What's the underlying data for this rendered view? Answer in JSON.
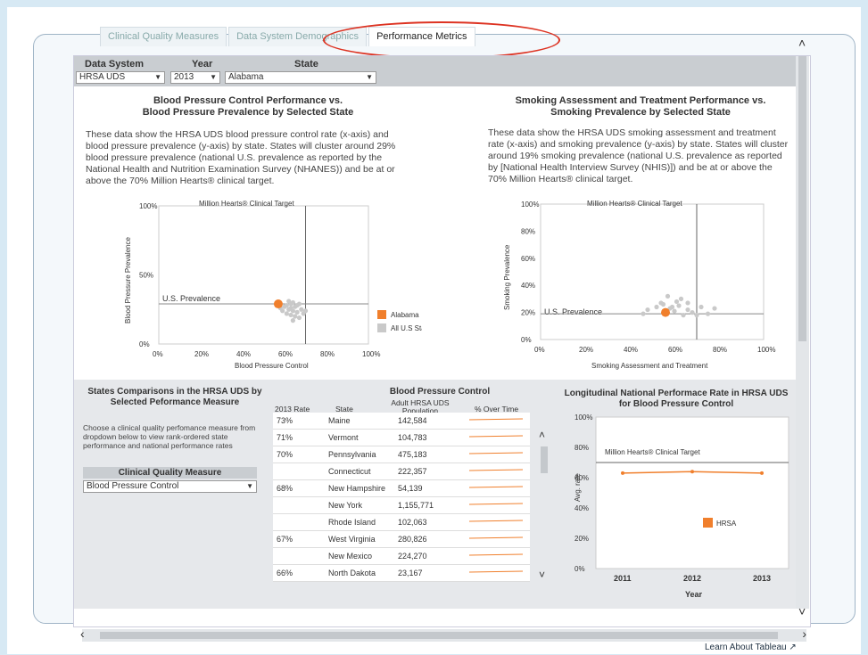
{
  "tabs": [
    "Clinical Quality Measures",
    "Data System Demographics",
    "Performance Metrics"
  ],
  "filters": {
    "data_system_label": "Data System",
    "data_system_value": "HRSA UDS",
    "year_label": "Year",
    "year_value": "2013",
    "state_label": "State",
    "state_value": "Alabama"
  },
  "bp_panel": {
    "title_line1": "Blood Pressure Control Performance vs.",
    "title_line2": "Blood Pressure Prevalence by Selected State",
    "desc": "These data show the HRSA UDS blood pressure control rate (x-axis) and blood pressure prevalence (y-axis) by state. States will cluster around 29% blood pressure prevalence (national U.S. prevalence as reported by the National Health and Nutrition Examination Survey (NHANES)) and be at or above the 70% Million Hearts® clinical target.",
    "target_label": "Million Hearts® Clinical Target",
    "prevalence_label": "U.S. Prevalence",
    "xlabel": "Blood Pressure Control",
    "ylabel": "Blood Pressure Prevalence",
    "legend_selected": "Alabama",
    "legend_all": "All U.S States"
  },
  "smoking_panel": {
    "title_line1": "Smoking Assessment and Treatment Performance vs.",
    "title_line2": "Smoking Prevalence by Selected State",
    "desc": "These data show the HRSA UDS smoking assessment and treatment rate (x-axis) and smoking prevalence (y-axis) by state. States will cluster around 19% smoking prevalence (national U.S. prevalence as reported by [National Health Interview Survey (NHIS)]) and be at or above the 70% Million Hearts® clinical target.",
    "target_label": "Million Hearts® Clinical Target",
    "prevalence_label": "U.S. Prevalence",
    "xlabel": "Smoking Assessment and Treatment",
    "ylabel": "Smoking Prevalence"
  },
  "comparison": {
    "title_line1": "States Comparisons in the HRSA UDS by",
    "title_line2": "Selected Peformance Measure",
    "hint": "Choose a clinical quality perfomance measure from dropdown below to view rank-ordered state performance and national performance rates",
    "cqm_label": "Clinical Quality Measure",
    "cqm_value": "Blood Pressure Control"
  },
  "bp_table": {
    "title": "Blood Pressure Control",
    "headers": [
      "2013 Rate",
      "State",
      "Adult HRSA UDS Population",
      "% Over Time"
    ],
    "rows": [
      {
        "rate": "73%",
        "state": "Maine",
        "pop": "142,584"
      },
      {
        "rate": "71%",
        "state": "Vermont",
        "pop": "104,783"
      },
      {
        "rate": "70%",
        "state": "Pennsylvania",
        "pop": "475,183"
      },
      {
        "rate": "",
        "state": "Connecticut",
        "pop": "222,357"
      },
      {
        "rate": "68%",
        "state": "New Hampshire",
        "pop": "54,139"
      },
      {
        "rate": "",
        "state": "New York",
        "pop": "1,155,771"
      },
      {
        "rate": "",
        "state": "Rhode Island",
        "pop": "102,063"
      },
      {
        "rate": "67%",
        "state": "West Virginia",
        "pop": "280,826"
      },
      {
        "rate": "",
        "state": "New Mexico",
        "pop": "224,270"
      },
      {
        "rate": "66%",
        "state": "North Dakota",
        "pop": "23,167"
      }
    ]
  },
  "longitudinal": {
    "title_line1": "Longitudinal National Performace Rate in HRSA UDS",
    "title_line2": "for Blood Pressure Control",
    "ylabel": "Avg. rate",
    "xlabel": "Year",
    "target_label": "Million Hearts® Clinical Target",
    "legend": "HRSA"
  },
  "footer": {
    "learn": "Learn About Tableau"
  },
  "colors": {
    "accent": "#f07f2c",
    "scatter": "#c9c9c9",
    "ellipse": "#d32f2f"
  },
  "chart_data": [
    {
      "type": "scatter",
      "title": "Blood Pressure Control Performance vs. Blood Pressure Prevalence by Selected State",
      "xlabel": "Blood Pressure Control",
      "ylabel": "Blood Pressure Prevalence",
      "xlim": [
        0,
        100
      ],
      "ylim": [
        0,
        100
      ],
      "xticks": [
        "0%",
        "20%",
        "40%",
        "60%",
        "80%",
        "100%"
      ],
      "yticks": [
        "0%",
        "50%",
        "100%"
      ],
      "series": [
        {
          "name": "Alabama",
          "points": [
            [
              57,
              29
            ]
          ]
        },
        {
          "name": "All U.S States",
          "points": [
            [
              60,
              27
            ],
            [
              62,
              25
            ],
            [
              63,
              29
            ],
            [
              64,
              24
            ],
            [
              61,
              22
            ],
            [
              65,
              27
            ],
            [
              66,
              23
            ],
            [
              63,
              21
            ],
            [
              68,
              25
            ],
            [
              67,
              19
            ],
            [
              59,
              24
            ],
            [
              62,
              31
            ],
            [
              64,
              30
            ],
            [
              66,
              28
            ],
            [
              58,
              26
            ],
            [
              69,
              22
            ],
            [
              70,
              24
            ],
            [
              67,
              29
            ],
            [
              61,
              28
            ],
            [
              65,
              20
            ],
            [
              64,
              17
            ],
            [
              63,
              26
            ]
          ]
        }
      ]
    },
    {
      "type": "scatter",
      "title": "Smoking Assessment and Treatment Performance vs. Smoking Prevalence by Selected State",
      "xlabel": "Smoking Assessment and Treatment",
      "ylabel": "Smoking Prevalence",
      "xlim": [
        0,
        100
      ],
      "ylim": [
        0,
        100
      ],
      "xticks": [
        "0%",
        "20%",
        "40%",
        "60%",
        "80%",
        "100%"
      ],
      "yticks": [
        "0%",
        "20%",
        "40%",
        "60%",
        "80%",
        "100%"
      ],
      "series": [
        {
          "name": "Alabama",
          "points": [
            [
              56,
              20
            ]
          ]
        },
        {
          "name": "All U.S States",
          "points": [
            [
              48,
              22
            ],
            [
              52,
              24
            ],
            [
              55,
              26
            ],
            [
              58,
              23
            ],
            [
              60,
              21
            ],
            [
              62,
              25
            ],
            [
              64,
              18
            ],
            [
              66,
              22
            ],
            [
              68,
              20
            ],
            [
              72,
              24
            ],
            [
              75,
              19
            ],
            [
              78,
              23
            ],
            [
              54,
              27
            ],
            [
              61,
              28
            ],
            [
              57,
              32
            ],
            [
              63,
              30
            ],
            [
              59,
              24
            ],
            [
              70,
              18
            ],
            [
              46,
              19
            ],
            [
              66,
              27
            ]
          ]
        }
      ]
    },
    {
      "type": "line",
      "title": "Longitudinal National Performace Rate in HRSA UDS for Blood Pressure Control",
      "xlabel": "Year",
      "ylabel": "Avg. rate",
      "categories": [
        "2011",
        "2012",
        "2013"
      ],
      "series": [
        {
          "name": "HRSA",
          "values": [
            63,
            64,
            63
          ]
        }
      ],
      "ylim": [
        0,
        100
      ],
      "yticks": [
        "0%",
        "20%",
        "40%",
        "60%",
        "80%",
        "100%"
      ]
    }
  ]
}
